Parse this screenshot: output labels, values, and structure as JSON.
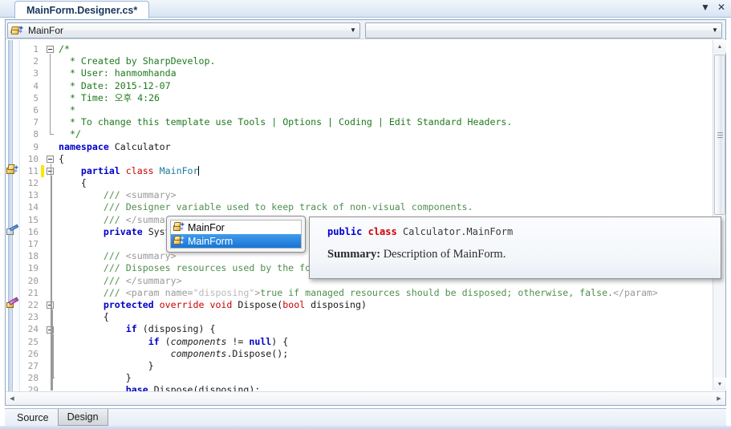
{
  "window": {
    "tab_title": "MainForm.Designer.cs*",
    "dropdown_icon": "chevron-down-icon",
    "dropdown_glyph": "▼",
    "close_icon": "close-icon",
    "close_glyph": "✕"
  },
  "toolbar": {
    "left_combo": {
      "value": "MainFor",
      "icon": "class-icon",
      "arrow_glyph": "▼"
    },
    "right_combo": {
      "value": "",
      "arrow_glyph": "▼"
    }
  },
  "editor": {
    "first_line": 1,
    "lines": [
      {
        "n": 1,
        "tokens": [
          {
            "t": "/*",
            "c": "c-comment"
          }
        ]
      },
      {
        "n": 2,
        "tokens": [
          {
            "t": "  * Created by SharpDevelop.",
            "c": "c-comment"
          }
        ]
      },
      {
        "n": 3,
        "tokens": [
          {
            "t": "  * User: hanmomhanda",
            "c": "c-comment"
          }
        ]
      },
      {
        "n": 4,
        "tokens": [
          {
            "t": "  * Date: 2015-12-07",
            "c": "c-comment"
          }
        ]
      },
      {
        "n": 5,
        "tokens": [
          {
            "t": "  * Time: 오후 4:26",
            "c": "c-comment"
          }
        ]
      },
      {
        "n": 6,
        "tokens": [
          {
            "t": "  *",
            "c": "c-comment"
          }
        ]
      },
      {
        "n": 7,
        "tokens": [
          {
            "t": "  * To change this template use Tools | Options | Coding | Edit Standard Headers.",
            "c": "c-comment"
          }
        ]
      },
      {
        "n": 8,
        "tokens": [
          {
            "t": "  */",
            "c": "c-comment"
          }
        ]
      },
      {
        "n": 9,
        "tokens": [
          {
            "t": "namespace",
            "c": "c-kw"
          },
          {
            "t": " Calculator",
            "c": "c-plain"
          }
        ]
      },
      {
        "n": 10,
        "tokens": [
          {
            "t": "{",
            "c": "c-plain"
          }
        ]
      },
      {
        "n": 11,
        "tokens": [
          {
            "t": "    partial ",
            "c": "c-kw"
          },
          {
            "t": "class",
            "c": "c-kw2"
          },
          {
            "t": " ",
            "c": "c-plain"
          },
          {
            "t": "MainFor",
            "c": "c-cls"
          }
        ],
        "caret": true
      },
      {
        "n": 12,
        "tokens": [
          {
            "t": "    {",
            "c": "c-plain"
          }
        ]
      },
      {
        "n": 13,
        "tokens": [
          {
            "t": "        /// ",
            "c": "c-doc"
          },
          {
            "t": "<summary>",
            "c": "c-doctag"
          }
        ]
      },
      {
        "n": 14,
        "tokens": [
          {
            "t": "        /// Designer variable used to keep track of non-visual components.",
            "c": "c-doc"
          }
        ]
      },
      {
        "n": 15,
        "tokens": [
          {
            "t": "        /// ",
            "c": "c-doc"
          },
          {
            "t": "</summary>",
            "c": "c-doctag"
          }
        ]
      },
      {
        "n": 16,
        "tokens": [
          {
            "t": "        ",
            "c": "c-plain"
          },
          {
            "t": "private",
            "c": "c-kw"
          },
          {
            "t": " System.ComponentModel.IConta",
            "c": "c-plain"
          }
        ]
      },
      {
        "n": 17,
        "tokens": [
          {
            "t": "",
            "c": "c-plain"
          }
        ]
      },
      {
        "n": 18,
        "tokens": [
          {
            "t": "        /// ",
            "c": "c-doc"
          },
          {
            "t": "<summary>",
            "c": "c-doctag"
          }
        ]
      },
      {
        "n": 19,
        "tokens": [
          {
            "t": "        /// Disposes resources used by the form.",
            "c": "c-doc"
          }
        ]
      },
      {
        "n": 20,
        "tokens": [
          {
            "t": "        /// ",
            "c": "c-doc"
          },
          {
            "t": "</summary>",
            "c": "c-doctag"
          }
        ]
      },
      {
        "n": 21,
        "tokens": [
          {
            "t": "        /// ",
            "c": "c-doc"
          },
          {
            "t": "<param name=",
            "c": "c-doctag"
          },
          {
            "t": "\"disposing\"",
            "c": "c-docstr"
          },
          {
            "t": ">",
            "c": "c-doctag"
          },
          {
            "t": "true if managed resources should be disposed; otherwise, false.",
            "c": "c-doc"
          },
          {
            "t": "</param>",
            "c": "c-doctag"
          }
        ]
      },
      {
        "n": 22,
        "tokens": [
          {
            "t": "        ",
            "c": "c-plain"
          },
          {
            "t": "protected ",
            "c": "c-kw"
          },
          {
            "t": "override void ",
            "c": "c-kw2"
          },
          {
            "t": "Dispose(",
            "c": "c-plain"
          },
          {
            "t": "bool",
            "c": "c-kw2"
          },
          {
            "t": " disposing)",
            "c": "c-plain"
          }
        ]
      },
      {
        "n": 23,
        "tokens": [
          {
            "t": "        {",
            "c": "c-plain"
          }
        ]
      },
      {
        "n": 24,
        "tokens": [
          {
            "t": "            ",
            "c": "c-plain"
          },
          {
            "t": "if",
            "c": "c-kw"
          },
          {
            "t": " (disposing) {",
            "c": "c-plain"
          }
        ]
      },
      {
        "n": 25,
        "tokens": [
          {
            "t": "                ",
            "c": "c-plain"
          },
          {
            "t": "if",
            "c": "c-kw"
          },
          {
            "t": " (",
            "c": "c-plain"
          },
          {
            "t": "components",
            "c": "c-ital"
          },
          {
            "t": " != ",
            "c": "c-plain"
          },
          {
            "t": "null",
            "c": "c-kw"
          },
          {
            "t": ") {",
            "c": "c-plain"
          }
        ]
      },
      {
        "n": 26,
        "tokens": [
          {
            "t": "                    ",
            "c": "c-plain"
          },
          {
            "t": "components",
            "c": "c-ital"
          },
          {
            "t": ".Dispose();",
            "c": "c-plain"
          }
        ]
      },
      {
        "n": 27,
        "tokens": [
          {
            "t": "                }",
            "c": "c-plain"
          }
        ]
      },
      {
        "n": 28,
        "tokens": [
          {
            "t": "            }",
            "c": "c-plain"
          }
        ]
      },
      {
        "n": 29,
        "tokens": [
          {
            "t": "            ",
            "c": "c-plain"
          },
          {
            "t": "base",
            "c": "c-kw"
          },
          {
            "t": ".Dispose(disposing);",
            "c": "c-plain"
          }
        ]
      }
    ],
    "gutter_icons": [
      {
        "line": 11,
        "kind": "gi-a",
        "name": "class-bookmark-icon"
      },
      {
        "line": 16,
        "kind": "gi-b",
        "name": "field-bookmark-icon"
      },
      {
        "line": 22,
        "kind": "gi-c",
        "name": "method-bookmark-icon"
      }
    ],
    "change_bar_lines": [
      11
    ],
    "change_bar_color": "#ffe500",
    "fold_markers": [
      1,
      10,
      11,
      22,
      24
    ]
  },
  "completion": {
    "items": [
      {
        "label": "MainFor",
        "selected": false,
        "icon": "class-icon"
      },
      {
        "label": "MainForm",
        "selected": true,
        "icon": "class-icon"
      }
    ]
  },
  "tooltip": {
    "signature": [
      {
        "t": "public",
        "c": "tt-kw-blue"
      },
      {
        "t": " ",
        "c": "tt-id"
      },
      {
        "t": "class",
        "c": "tt-kw-red"
      },
      {
        "t": " Calculator.MainForm",
        "c": "tt-id"
      }
    ],
    "summary_label": "Summary:",
    "summary_text": "Description of MainForm."
  },
  "scrollbars": {
    "vertical": {
      "up_glyph": "▲",
      "down_glyph": "▼"
    },
    "horizontal": {
      "left_glyph": "◀",
      "right_glyph": "▶"
    }
  },
  "view_tabs": [
    {
      "label": "Source",
      "active": true
    },
    {
      "label": "Design",
      "active": false
    }
  ],
  "colors": {
    "accent": "#1774d4",
    "comment": "#1f7a1f",
    "keyword_blue": "#0000c8",
    "keyword_red": "#cc0000",
    "change_bar": "#ffe500"
  }
}
